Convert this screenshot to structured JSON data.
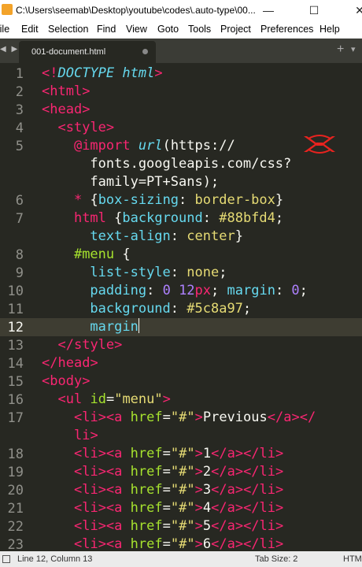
{
  "window": {
    "title": "C:\\Users\\seemab\\Desktop\\youtube\\codes\\.auto-type\\00...",
    "minimize": "—",
    "maximize": "☐",
    "close": "✕"
  },
  "menu": [
    "File",
    "Edit",
    "Selection",
    "Find",
    "View",
    "Goto",
    "Tools",
    "Project",
    "Preferences",
    "Help"
  ],
  "tab": {
    "label": "001-document.html",
    "modified_dot": true
  },
  "tabbar": {
    "nav": "◀ ▶",
    "add": "+",
    "more": "▾"
  },
  "editor": {
    "current_line": 12,
    "gutter": [
      "1",
      "2",
      "3",
      "4",
      "5",
      "",
      "",
      "6",
      "7",
      "",
      "8",
      "9",
      "10",
      "11",
      "12",
      "13",
      "14",
      "15",
      "16",
      "17",
      "",
      "18",
      "19",
      "20",
      "21",
      "22",
      "23"
    ],
    "lines": [
      [
        [
          "<!",
          "t"
        ],
        [
          "DOCTYPE html",
          "c"
        ],
        [
          ">",
          "t"
        ]
      ],
      [
        [
          "<",
          "t"
        ],
        [
          "html",
          "t"
        ],
        [
          ">",
          "t"
        ]
      ],
      [
        [
          "<",
          "t"
        ],
        [
          "head",
          "t"
        ],
        [
          ">",
          "t"
        ]
      ],
      [
        [
          "  ",
          "p"
        ],
        [
          "<",
          "t"
        ],
        [
          "style",
          "t"
        ],
        [
          ">",
          "t"
        ]
      ],
      [
        [
          "    ",
          "p"
        ],
        [
          "@import",
          "t"
        ],
        [
          " ",
          "p"
        ],
        [
          "url",
          "c"
        ],
        [
          "(https://",
          "p"
        ]
      ],
      [
        [
          "      fonts.googleapis.com/css?",
          "p"
        ]
      ],
      [
        [
          "      family=PT+Sans);",
          "p"
        ]
      ],
      [
        [
          "    ",
          "p"
        ],
        [
          "*",
          "t"
        ],
        [
          " {",
          "p"
        ],
        [
          "box-sizing",
          "k"
        ],
        [
          ": ",
          "p"
        ],
        [
          "border-box",
          "s"
        ],
        [
          "}",
          "p"
        ]
      ],
      [
        [
          "    ",
          "p"
        ],
        [
          "html",
          "t"
        ],
        [
          " {",
          "p"
        ],
        [
          "background",
          "k"
        ],
        [
          ": ",
          "p"
        ],
        [
          "#88bfd4",
          "s"
        ],
        [
          ";",
          "p"
        ]
      ],
      [
        [
          "      ",
          "p"
        ],
        [
          "text-align",
          "k"
        ],
        [
          ": ",
          "p"
        ],
        [
          "center",
          "s"
        ],
        [
          "}",
          "p"
        ]
      ],
      [
        [
          "    ",
          "p"
        ],
        [
          "#menu",
          "a"
        ],
        [
          " {",
          "p"
        ]
      ],
      [
        [
          "      ",
          "p"
        ],
        [
          "list-style",
          "k"
        ],
        [
          ": ",
          "p"
        ],
        [
          "none",
          "s"
        ],
        [
          ";",
          "p"
        ]
      ],
      [
        [
          "      ",
          "p"
        ],
        [
          "padding",
          "k"
        ],
        [
          ": ",
          "p"
        ],
        [
          "0",
          "n"
        ],
        [
          " ",
          "p"
        ],
        [
          "12",
          "n"
        ],
        [
          "px",
          "t"
        ],
        [
          "; ",
          "p"
        ],
        [
          "margin",
          "k"
        ],
        [
          ": ",
          "p"
        ],
        [
          "0",
          "n"
        ],
        [
          ";",
          "p"
        ]
      ],
      [
        [
          "      ",
          "p"
        ],
        [
          "background",
          "k"
        ],
        [
          ": ",
          "p"
        ],
        [
          "#5c8a97",
          "s"
        ],
        [
          ";",
          "p"
        ]
      ],
      [
        [
          "      ",
          "p"
        ],
        [
          "margin",
          "k"
        ]
      ],
      [
        [
          "  ",
          "p"
        ],
        [
          "</",
          "t"
        ],
        [
          "style",
          "t"
        ],
        [
          ">",
          "t"
        ]
      ],
      [
        [
          "</",
          "t"
        ],
        [
          "head",
          "t"
        ],
        [
          ">",
          "t"
        ]
      ],
      [
        [
          "<",
          "t"
        ],
        [
          "body",
          "t"
        ],
        [
          ">",
          "t"
        ]
      ],
      [
        [
          "  ",
          "p"
        ],
        [
          "<",
          "t"
        ],
        [
          "ul",
          "t"
        ],
        [
          " ",
          "p"
        ],
        [
          "id",
          "a"
        ],
        [
          "=",
          "p"
        ],
        [
          "\"menu\"",
          "s"
        ],
        [
          ">",
          "t"
        ]
      ],
      [
        [
          "    ",
          "p"
        ],
        [
          "<",
          "t"
        ],
        [
          "li",
          "t"
        ],
        [
          "><",
          "t"
        ],
        [
          "a",
          "t"
        ],
        [
          " ",
          "p"
        ],
        [
          "href",
          "a"
        ],
        [
          "=",
          "p"
        ],
        [
          "\"#\"",
          "s"
        ],
        [
          ">",
          "t"
        ],
        [
          "Previous",
          "p"
        ],
        [
          "</",
          "t"
        ],
        [
          "a",
          "t"
        ],
        [
          "></",
          "t"
        ]
      ],
      [
        [
          "    ",
          "p"
        ],
        [
          "li",
          "t"
        ],
        [
          ">",
          "t"
        ]
      ],
      [
        [
          "    ",
          "p"
        ],
        [
          "<",
          "t"
        ],
        [
          "li",
          "t"
        ],
        [
          "><",
          "t"
        ],
        [
          "a",
          "t"
        ],
        [
          " ",
          "p"
        ],
        [
          "href",
          "a"
        ],
        [
          "=",
          "p"
        ],
        [
          "\"#\"",
          "s"
        ],
        [
          ">",
          "t"
        ],
        [
          "1",
          "p"
        ],
        [
          "</",
          "t"
        ],
        [
          "a",
          "t"
        ],
        [
          "></",
          "t"
        ],
        [
          "li",
          "t"
        ],
        [
          ">",
          "t"
        ]
      ],
      [
        [
          "    ",
          "p"
        ],
        [
          "<",
          "t"
        ],
        [
          "li",
          "t"
        ],
        [
          "><",
          "t"
        ],
        [
          "a",
          "t"
        ],
        [
          " ",
          "p"
        ],
        [
          "href",
          "a"
        ],
        [
          "=",
          "p"
        ],
        [
          "\"#\"",
          "s"
        ],
        [
          ">",
          "t"
        ],
        [
          "2",
          "p"
        ],
        [
          "</",
          "t"
        ],
        [
          "a",
          "t"
        ],
        [
          "></",
          "t"
        ],
        [
          "li",
          "t"
        ],
        [
          ">",
          "t"
        ]
      ],
      [
        [
          "    ",
          "p"
        ],
        [
          "<",
          "t"
        ],
        [
          "li",
          "t"
        ],
        [
          "><",
          "t"
        ],
        [
          "a",
          "t"
        ],
        [
          " ",
          "p"
        ],
        [
          "href",
          "a"
        ],
        [
          "=",
          "p"
        ],
        [
          "\"#\"",
          "s"
        ],
        [
          ">",
          "t"
        ],
        [
          "3",
          "p"
        ],
        [
          "</",
          "t"
        ],
        [
          "a",
          "t"
        ],
        [
          "></",
          "t"
        ],
        [
          "li",
          "t"
        ],
        [
          ">",
          "t"
        ]
      ],
      [
        [
          "    ",
          "p"
        ],
        [
          "<",
          "t"
        ],
        [
          "li",
          "t"
        ],
        [
          "><",
          "t"
        ],
        [
          "a",
          "t"
        ],
        [
          " ",
          "p"
        ],
        [
          "href",
          "a"
        ],
        [
          "=",
          "p"
        ],
        [
          "\"#\"",
          "s"
        ],
        [
          ">",
          "t"
        ],
        [
          "4",
          "p"
        ],
        [
          "</",
          "t"
        ],
        [
          "a",
          "t"
        ],
        [
          "></",
          "t"
        ],
        [
          "li",
          "t"
        ],
        [
          ">",
          "t"
        ]
      ],
      [
        [
          "    ",
          "p"
        ],
        [
          "<",
          "t"
        ],
        [
          "li",
          "t"
        ],
        [
          "><",
          "t"
        ],
        [
          "a",
          "t"
        ],
        [
          " ",
          "p"
        ],
        [
          "href",
          "a"
        ],
        [
          "=",
          "p"
        ],
        [
          "\"#\"",
          "s"
        ],
        [
          ">",
          "t"
        ],
        [
          "5",
          "p"
        ],
        [
          "</",
          "t"
        ],
        [
          "a",
          "t"
        ],
        [
          "></",
          "t"
        ],
        [
          "li",
          "t"
        ],
        [
          ">",
          "t"
        ]
      ],
      [
        [
          "    ",
          "p"
        ],
        [
          "<",
          "t"
        ],
        [
          "li",
          "t"
        ],
        [
          "><",
          "t"
        ],
        [
          "a",
          "t"
        ],
        [
          " ",
          "p"
        ],
        [
          "href",
          "a"
        ],
        [
          "=",
          "p"
        ],
        [
          "\"#\"",
          "s"
        ],
        [
          ">",
          "t"
        ],
        [
          "6",
          "p"
        ],
        [
          "</",
          "t"
        ],
        [
          "a",
          "t"
        ],
        [
          "></",
          "t"
        ],
        [
          "li",
          "t"
        ],
        [
          ">",
          "t"
        ]
      ]
    ]
  },
  "status": {
    "position": "Line 12, Column 13",
    "tab_size": "Tab Size: 2",
    "syntax": "HTML"
  },
  "colors": {
    "bg": "#272822",
    "tag": "#f92672",
    "attr": "#a6e22e",
    "string": "#e6db74",
    "keyword": "#66d9ef",
    "number": "#ae81ff",
    "logo": "#e8231f"
  }
}
